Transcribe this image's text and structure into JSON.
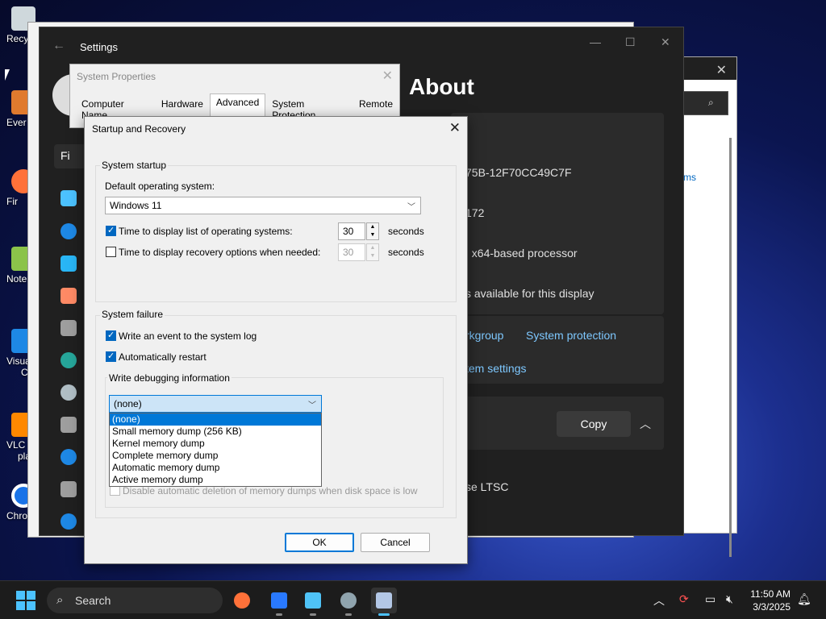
{
  "desktop": {
    "icons": [
      {
        "label": "Recy"
      },
      {
        "label": "Ever"
      },
      {
        "label": "Fir"
      },
      {
        "label": "Note"
      },
      {
        "label": "Visua"
      },
      {
        "label": "VLC m"
      },
      {
        "label": "Chrom"
      }
    ],
    "icons_second_line": {
      "visual": "C",
      "vlc": "playe"
    }
  },
  "bg_window": {
    "partial_link": "ms"
  },
  "settings": {
    "title": "Settings",
    "page_title": "About",
    "find_partial": "Fi",
    "values": {
      "product_id_partial": "75B-12F70CC49C7F",
      "build_partial": "172",
      "system_type_partial": ", x64-based processor",
      "pen_touch_partial": "s available for this display"
    },
    "links": {
      "workgroup_partial": "rkgroup",
      "system_protection": "System protection",
      "advanced_partial": "tem settings"
    },
    "copy_label": "Copy",
    "edition_partial": "se LTSC"
  },
  "system_properties": {
    "title": "System Properties",
    "tabs": [
      "Computer Name",
      "Hardware",
      "Advanced",
      "System Protection",
      "Remote"
    ],
    "active_tab": "Advanced"
  },
  "dialog": {
    "title": "Startup and Recovery",
    "system_startup": {
      "group_label": "System startup",
      "default_os_label": "Default operating system:",
      "default_os_value": "Windows 11",
      "display_list_label": "Time to display list of operating systems:",
      "display_list_value": "30",
      "display_list_checked": true,
      "recovery_label": "Time to display recovery options when needed:",
      "recovery_value": "30",
      "recovery_checked": false,
      "seconds": "seconds"
    },
    "system_failure": {
      "group_label": "System failure",
      "write_event_label": "Write an event to the system log",
      "write_event_checked": true,
      "auto_restart_label": "Automatically restart",
      "auto_restart_checked": true,
      "debug_group_label": "Write debugging information",
      "debug_selected": "(none)",
      "debug_options": [
        "(none)",
        "Small memory dump (256 KB)",
        "Kernel memory dump",
        "Complete memory dump",
        "Automatic memory dump",
        "Active memory dump"
      ],
      "disable_auto_delete_label": "Disable automatic deletion of memory dumps when disk space is low"
    },
    "ok_label": "OK",
    "cancel_label": "Cancel"
  },
  "taskbar": {
    "search_label": "Search",
    "time": "11:50 AM",
    "date": "3/3/2025"
  },
  "colors": {
    "accent": "#0078d7",
    "settings_bg": "#202020",
    "link": "#7ec8ff"
  }
}
